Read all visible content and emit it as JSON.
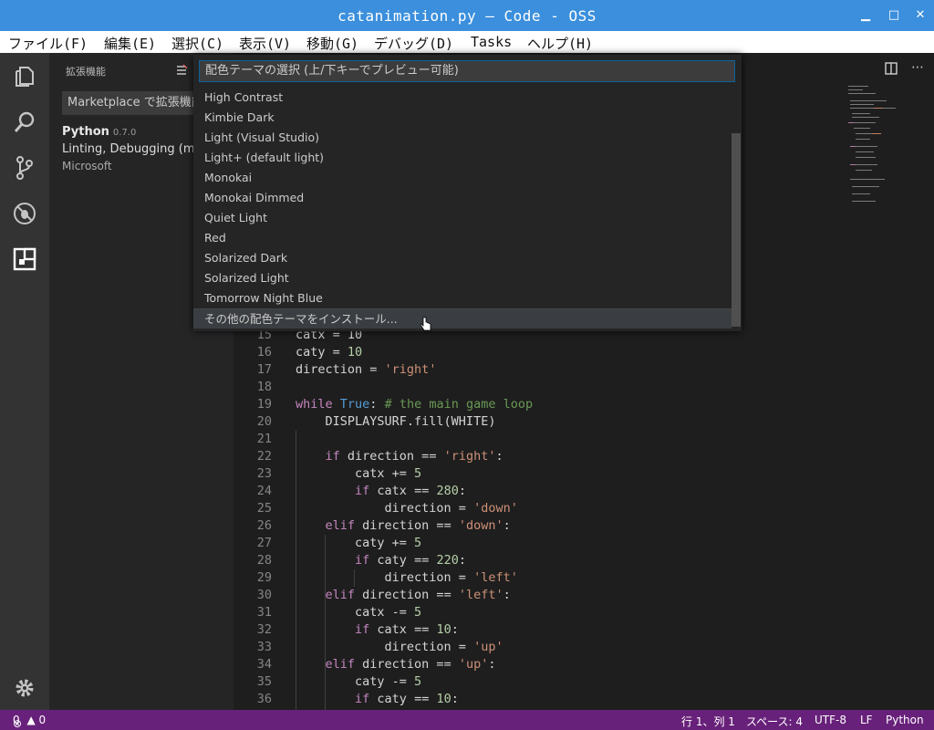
{
  "window": {
    "title": "catanimation.py — Code - OSS"
  },
  "menu": [
    "ファイル(F)",
    "編集(E)",
    "選択(C)",
    "表示(V)",
    "移動(G)",
    "デバッグ(D)",
    "Tasks",
    "ヘルプ(H)"
  ],
  "activity_bar": [
    "explorer-icon",
    "search-icon",
    "source-control-icon",
    "debug-icon",
    "extensions-icon",
    "gear-icon"
  ],
  "sidebar": {
    "title": "拡張機能",
    "search_placeholder": "Marketplace で拡張機能",
    "extension": {
      "name": "Python",
      "version": "0.7.0",
      "description": "Linting, Debugging (multi-",
      "publisher": "Microsoft"
    }
  },
  "quickpick": {
    "placeholder": "配色テーマの選択 (上/下キーでプレビュー可能)",
    "items": [
      "High Contrast",
      "Kimbie Dark",
      "Light (Visual Studio)",
      "Light+ (default light)",
      "Monokai",
      "Monokai Dimmed",
      "Quiet Light",
      "Red",
      "Solarized Dark",
      "Solarized Light",
      "Tomorrow Night Blue",
      "その他の配色テーマをインストール..."
    ]
  },
  "code": [
    {
      "n": "15",
      "t": "catx = 10"
    },
    {
      "n": "16",
      "t": "caty = 10"
    },
    {
      "n": "17",
      "t": "direction = 'right'"
    },
    {
      "n": "18",
      "t": ""
    },
    {
      "n": "19",
      "t": "while True: # the main game loop"
    },
    {
      "n": "20",
      "t": "    DISPLAYSURF.fill(WHITE)"
    },
    {
      "n": "21",
      "t": ""
    },
    {
      "n": "22",
      "t": "    if direction == 'right':"
    },
    {
      "n": "23",
      "t": "        catx += 5"
    },
    {
      "n": "24",
      "t": "        if catx == 280:"
    },
    {
      "n": "25",
      "t": "            direction = 'down'"
    },
    {
      "n": "26",
      "t": "    elif direction == 'down':"
    },
    {
      "n": "27",
      "t": "        caty += 5"
    },
    {
      "n": "28",
      "t": "        if caty == 220:"
    },
    {
      "n": "29",
      "t": "            direction = 'left'"
    },
    {
      "n": "30",
      "t": "    elif direction == 'left':"
    },
    {
      "n": "31",
      "t": "        catx -= 5"
    },
    {
      "n": "32",
      "t": "        if catx == 10:"
    },
    {
      "n": "33",
      "t": "            direction = 'up'"
    },
    {
      "n": "34",
      "t": "    elif direction == 'up':"
    },
    {
      "n": "35",
      "t": "        caty -= 5"
    },
    {
      "n": "36",
      "t": "        if caty == 10:"
    }
  ],
  "status": {
    "errors": "0",
    "warnings": "0",
    "position": "行 1、列 1",
    "spaces": "スペース: 4",
    "encoding": "UTF-8",
    "eol": "LF",
    "language": "Python"
  },
  "colors": {
    "title_bar": "#3b8fdc",
    "status_bar": "#68217a",
    "accent": "#0e639c"
  }
}
